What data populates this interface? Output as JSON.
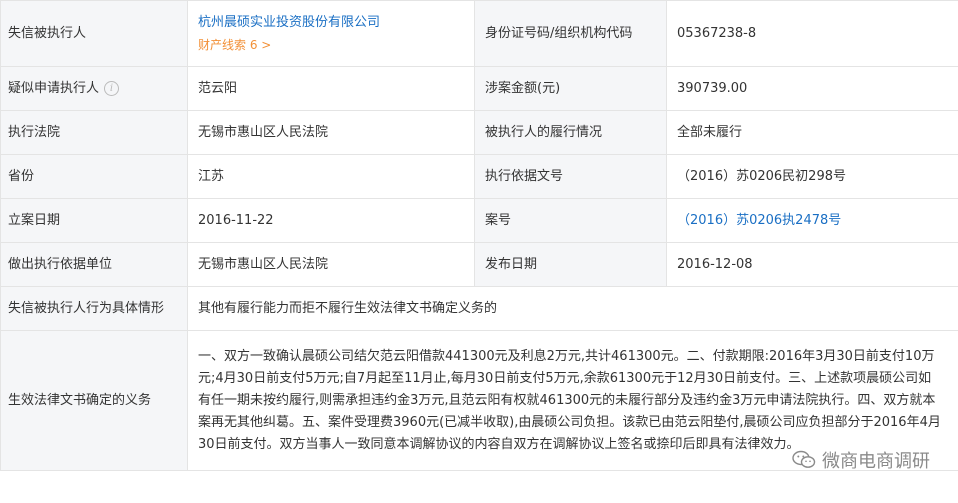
{
  "rows": {
    "r1": {
      "label1": "失信被执行人",
      "company": "杭州晨硕实业投资股份有限公司",
      "property_clues": "财产线索 6 >",
      "label2": "身份证号码/组织机构代码",
      "value2": "05367238-8"
    },
    "r2": {
      "label1": "疑似申请执行人",
      "value1": "范云阳",
      "label2": "涉案金额(元)",
      "value2": "390739.00"
    },
    "r3": {
      "label1": "执行法院",
      "value1": "无锡市惠山区人民法院",
      "label2": "被执行人的履行情况",
      "value2": "全部未履行"
    },
    "r4": {
      "label1": "省份",
      "value1": "江苏",
      "label2": "执行依据文号",
      "value2": "（2016）苏0206民初298号"
    },
    "r5": {
      "label1": "立案日期",
      "value1": "2016-11-22",
      "label2": "案号",
      "value2": "（2016）苏0206执2478号"
    },
    "r6": {
      "label1": "做出执行依据单位",
      "value1": "无锡市惠山区人民法院",
      "label2": "发布日期",
      "value2": "2016-12-08"
    },
    "r7": {
      "label1": "失信被执行人行为具体情形",
      "value1": "其他有履行能力而拒不履行生效法律文书确定义务的"
    },
    "r8": {
      "label1": "生效法律文书确定的义务",
      "value1": "一、双方一致确认晨硕公司结欠范云阳借款441300元及利息2万元,共计461300元。二、付款期限:2016年3月30日前支付10万元;4月30日前支付5万元;自7月起至11月止,每月30日前支付5万元,余款61300元于12月30日前支付。三、上述款项晨硕公司如有任一期未按约履行,则需承担违约金3万元,且范云阳有权就461300元的未履行部分及违约金3万元申请法院执行。四、双方就本案再无其他纠葛。五、案件受理费3960元(已减半收取),由晨硕公司负担。该款已由范云阳垫付,晨硕公司应负担部分于2016年4月30日前支付。双方当事人一致同意本调解协议的内容自双方在调解协议上签名或捺印后即具有法律效力。"
    }
  },
  "watermark": {
    "text": "微商电商调研",
    "icon": "wechat-icon"
  },
  "colors": {
    "label_bg": "#f5f6f8",
    "border": "#e4e4e4",
    "link": "#1a6fc4",
    "accent": "#f29037"
  }
}
